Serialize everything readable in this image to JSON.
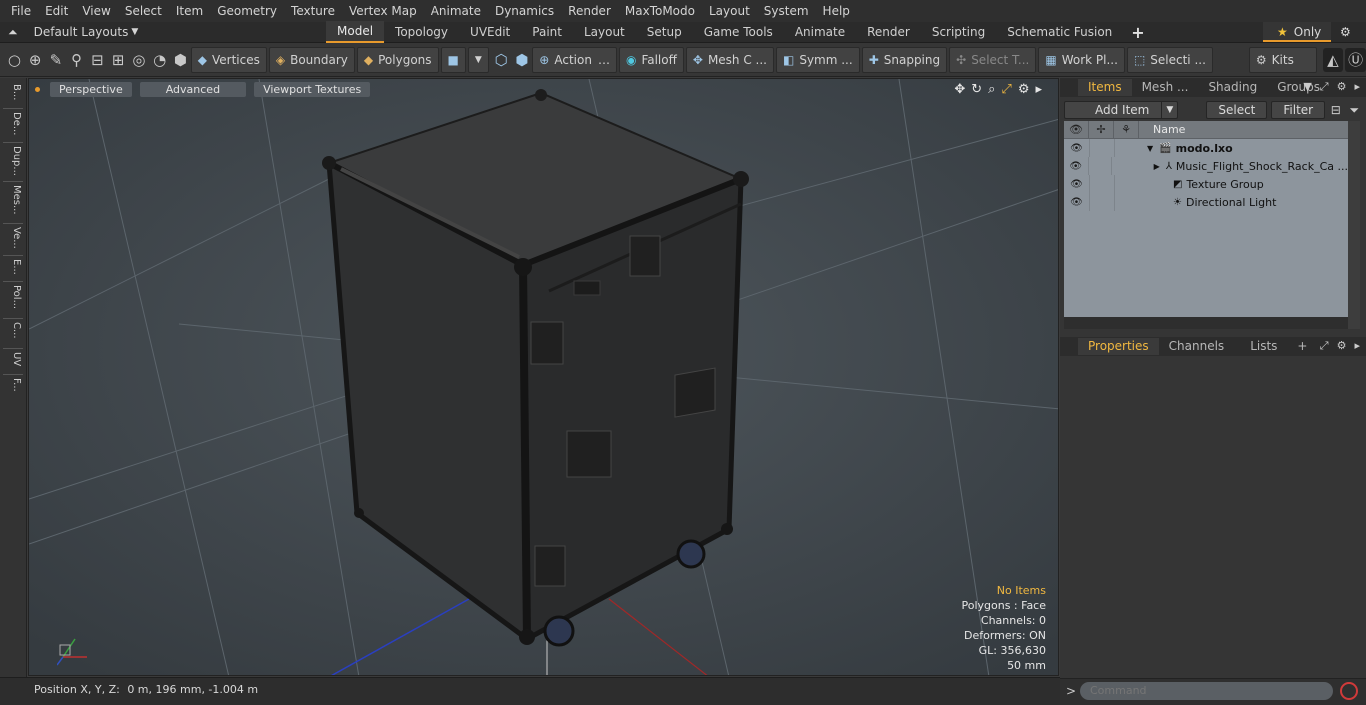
{
  "menu": [
    "File",
    "Edit",
    "View",
    "Select",
    "Item",
    "Geometry",
    "Texture",
    "Vertex Map",
    "Animate",
    "Dynamics",
    "Render",
    "MaxToModo",
    "Layout",
    "System",
    "Help"
  ],
  "layouts_label": "Default Layouts",
  "tabs": [
    "Model",
    "Topology",
    "UVEdit",
    "Paint",
    "Layout",
    "Setup",
    "Game Tools",
    "Animate",
    "Render",
    "Scripting",
    "Schematic Fusion"
  ],
  "active_tab": "Model",
  "only_label": "Only",
  "toolbar": {
    "vertices": "Vertices",
    "boundary": "Boundary",
    "polygons": "Polygons",
    "action": "Action",
    "falloff": "Falloff",
    "mesh": "Mesh C ...",
    "symm": "Symm ...",
    "snapping": "Snapping",
    "select_t": "Select T...",
    "work_pl": "Work Pl...",
    "selecti": "Selecti ...",
    "kits": "Kits"
  },
  "left_tabs": [
    "B...",
    "De...",
    "Dup...",
    "Mes...",
    "Ve...",
    "E...",
    "Pol...",
    "C...",
    "UV",
    "F..."
  ],
  "viewport": {
    "perspective": "Perspective",
    "advanced": "Advanced",
    "viewport_textures": "Viewport Textures",
    "info": {
      "no_items": "No Items",
      "polygons": "Polygons : Face",
      "channels": "Channels: 0",
      "deformers": "Deformers: ON",
      "gl": "GL: 356,630",
      "scale": "50 mm"
    }
  },
  "status": {
    "label": "Position X, Y, Z:",
    "value": "0 m, 196 mm, -1.004 m"
  },
  "items_panel": {
    "tabs": [
      "Items",
      "Mesh ...",
      "Shading",
      "Groups"
    ],
    "add_item": "Add Item",
    "select": "Select",
    "filter": "Filter",
    "name_header": "Name",
    "rows": [
      {
        "label": "modo.lxo",
        "bold": true,
        "depth": 0
      },
      {
        "label": "Music_Flight_Shock_Rack_Ca ...",
        "bold": false,
        "depth": 1
      },
      {
        "label": "Texture Group",
        "bold": false,
        "depth": 1
      },
      {
        "label": "Directional Light",
        "bold": false,
        "depth": 1
      }
    ]
  },
  "properties_panel": {
    "tabs": [
      "Properties",
      "Channels",
      "Lists"
    ]
  },
  "command_placeholder": "Command",
  "colors": {
    "accent": "#e89a2c",
    "info_highlight": "#f1b840"
  }
}
